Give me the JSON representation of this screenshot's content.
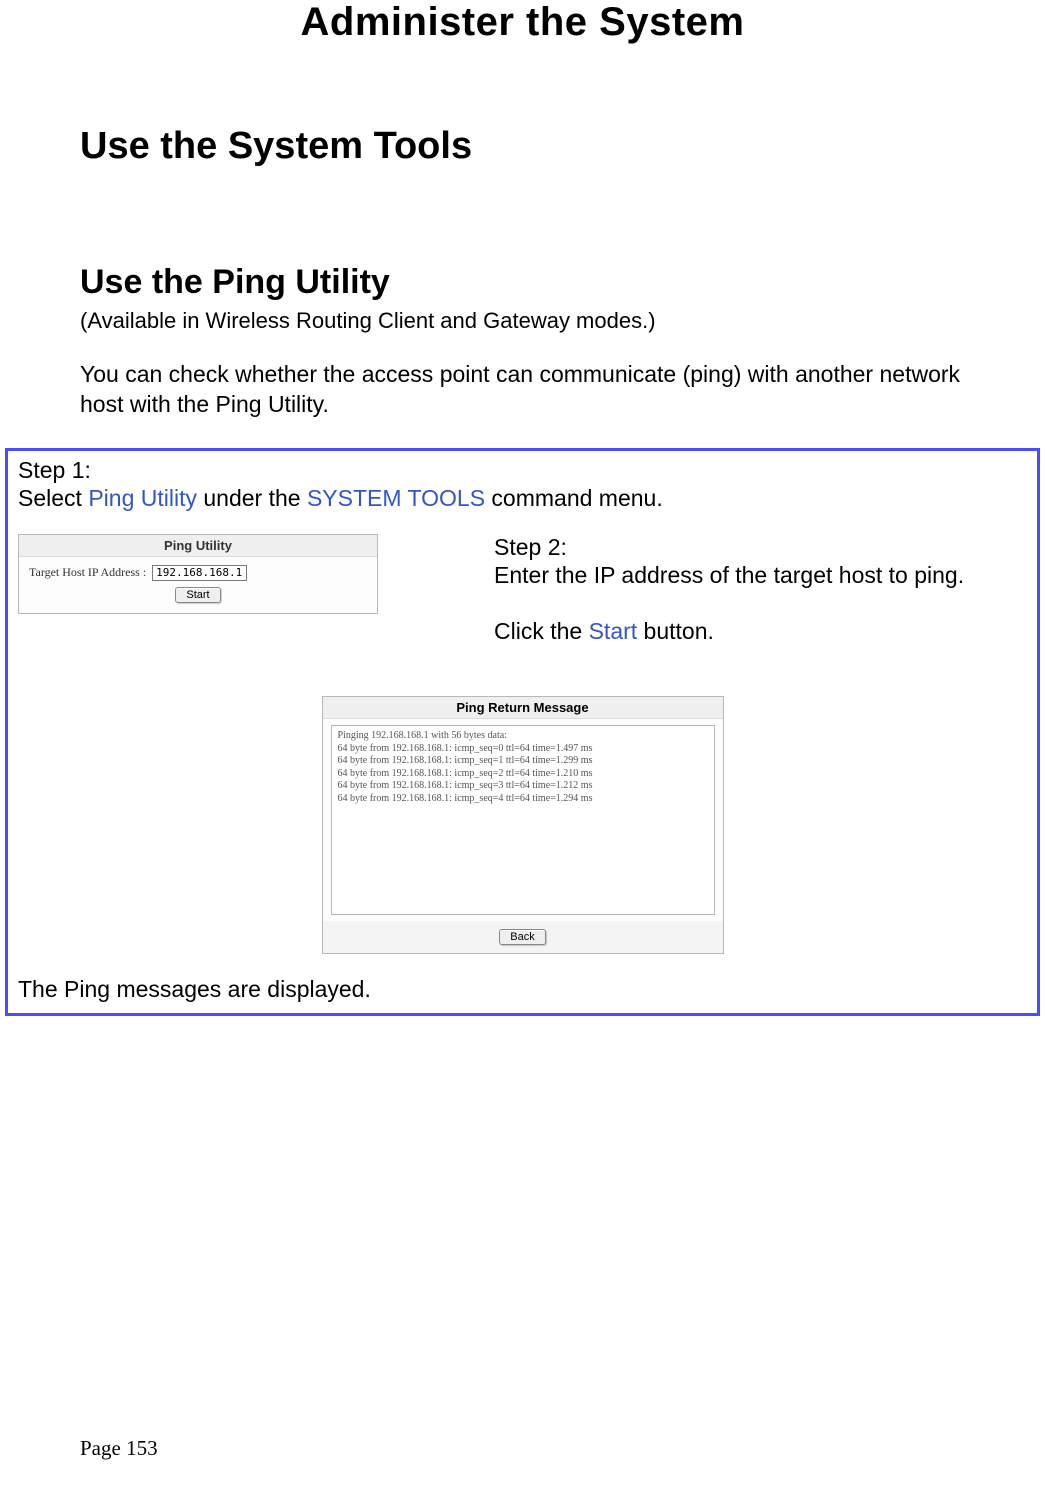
{
  "title": "Administer the System",
  "section_h2": "Use the System Tools",
  "section_h3": "Use the Ping Utility",
  "subtitle": "(Available in Wireless Routing Client and Gateway modes.)",
  "intro": "You can check whether the access point can communicate (ping) with another network host with the Ping Utility.",
  "step1": {
    "label": "Step 1:",
    "prefix": "Select ",
    "link1": "Ping Utility",
    "mid": " under the ",
    "link2": "SYSTEM TOOLS",
    "suffix": " command menu."
  },
  "ping_panel": {
    "title": "Ping Utility",
    "label": "Target Host IP Address :",
    "value": "192.168.168.1",
    "start_btn": "Start"
  },
  "step2": {
    "label": "Step 2:",
    "line1": "Enter the IP address of the target host to ping.",
    "line2_prefix": "Click the ",
    "line2_link": "Start",
    "line2_suffix": " button."
  },
  "return_panel": {
    "title": "Ping Return Message",
    "output": "Pinging 192.168.168.1 with 56 bytes data:\n64 byte from 192.168.168.1: icmp_seq=0 ttl=64 time=1.497 ms\n64 byte from 192.168.168.1: icmp_seq=1 ttl=64 time=1.299 ms\n64 byte from 192.168.168.1: icmp_seq=2 ttl=64 time=1.210 ms\n64 byte from 192.168.168.1: icmp_seq=3 ttl=64 time=1.212 ms\n64 byte from 192.168.168.1: icmp_seq=4 ttl=64 time=1.294 ms",
    "back_btn": "Back"
  },
  "closing": "The Ping messages are displayed.",
  "footer": "Page 153"
}
